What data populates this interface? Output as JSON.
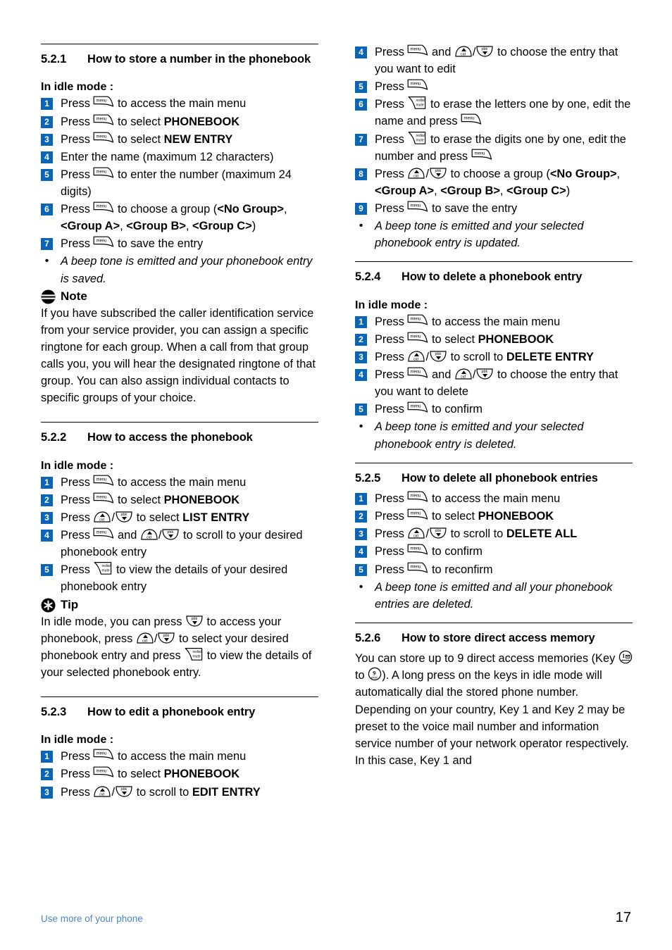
{
  "footer": {
    "left_text": "Use more of your phone",
    "page_number": "17",
    "link_color": "#4a86c8"
  },
  "theme": {
    "badge_color": "#0a66b5",
    "badge_text_color": "#ffffff"
  },
  "icons": {
    "menu": "menu-key-icon",
    "up": "up-cid-key-icon",
    "down": "down-pbk-key-icon",
    "redial": "redial-mute-key-icon",
    "note": "note-icon",
    "tip": "tip-icon",
    "key1": "key-1-icon",
    "key9": "key-9-icon",
    "menu_label": "menu",
    "up_label": "cid",
    "down_label": "pbk",
    "redial_label_top": "redial",
    "redial_label_bottom": "mute"
  },
  "left_column": {
    "s521": {
      "number": "5.2.1",
      "title": "How to store a number in the phonebook",
      "idle": "In idle mode :",
      "steps": [
        {
          "n": "1",
          "parts": [
            {
              "t": "text",
              "v": "Press "
            },
            {
              "t": "icon",
              "v": "menu"
            },
            {
              "t": "text",
              "v": " to access the main menu"
            }
          ]
        },
        {
          "n": "2",
          "parts": [
            {
              "t": "text",
              "v": "Press "
            },
            {
              "t": "icon",
              "v": "menu"
            },
            {
              "t": "text",
              "v": " to select "
            },
            {
              "t": "bold",
              "v": "PHONEBOOK"
            }
          ]
        },
        {
          "n": "3",
          "parts": [
            {
              "t": "text",
              "v": "Press "
            },
            {
              "t": "icon",
              "v": "menu"
            },
            {
              "t": "text",
              "v": " to select "
            },
            {
              "t": "bold",
              "v": "NEW ENTRY"
            }
          ]
        },
        {
          "n": "4",
          "parts": [
            {
              "t": "text",
              "v": "Enter the name (maximum 12 characters)"
            }
          ]
        },
        {
          "n": "5",
          "parts": [
            {
              "t": "text",
              "v": "Press "
            },
            {
              "t": "icon",
              "v": "menu"
            },
            {
              "t": "text",
              "v": " to enter the number (maximum 24 digits)"
            }
          ]
        },
        {
          "n": "6",
          "parts": [
            {
              "t": "text",
              "v": "Press "
            },
            {
              "t": "icon",
              "v": "menu"
            },
            {
              "t": "text",
              "v": " to choose a group ("
            },
            {
              "t": "bold",
              "v": "<No Group>"
            },
            {
              "t": "text",
              "v": ", "
            },
            {
              "t": "bold",
              "v": "<Group A>"
            },
            {
              "t": "text",
              "v": ", "
            },
            {
              "t": "bold",
              "v": "<Group B>"
            },
            {
              "t": "text",
              "v": ", "
            },
            {
              "t": "bold",
              "v": "<Group C>"
            },
            {
              "t": "text",
              "v": ")"
            }
          ]
        },
        {
          "n": "7",
          "parts": [
            {
              "t": "text",
              "v": "Press "
            },
            {
              "t": "icon",
              "v": "menu"
            },
            {
              "t": "text",
              "v": " to save the entry"
            }
          ]
        },
        {
          "n": "•",
          "italic": true,
          "parts": [
            {
              "t": "text",
              "v": "A beep tone is emitted and your phonebook entry is saved."
            }
          ]
        }
      ],
      "note": {
        "label": "Note",
        "text": "If you have subscribed the caller identification service from your service provider, you can assign a specific ringtone for each group. When a call from that group calls you, you will hear the designated ringtone of that group. You can also assign individual contacts to specific groups of your choice."
      }
    },
    "s522": {
      "number": "5.2.2",
      "title": "How to access the phonebook",
      "idle": "In idle mode :",
      "steps": [
        {
          "n": "1",
          "parts": [
            {
              "t": "text",
              "v": "Press "
            },
            {
              "t": "icon",
              "v": "menu"
            },
            {
              "t": "text",
              "v": " to access the main menu"
            }
          ]
        },
        {
          "n": "2",
          "parts": [
            {
              "t": "text",
              "v": "Press "
            },
            {
              "t": "icon",
              "v": "menu"
            },
            {
              "t": "text",
              "v": " to select "
            },
            {
              "t": "bold",
              "v": "PHONEBOOK"
            }
          ]
        },
        {
          "n": "3",
          "parts": [
            {
              "t": "text",
              "v": "Press "
            },
            {
              "t": "icon",
              "v": "up"
            },
            {
              "t": "text",
              "v": "/"
            },
            {
              "t": "icon",
              "v": "down"
            },
            {
              "t": "text",
              "v": " to select "
            },
            {
              "t": "bold",
              "v": "LIST ENTRY"
            }
          ]
        },
        {
          "n": "4",
          "parts": [
            {
              "t": "text",
              "v": "Press "
            },
            {
              "t": "icon",
              "v": "menu"
            },
            {
              "t": "text",
              "v": " and "
            },
            {
              "t": "icon",
              "v": "up"
            },
            {
              "t": "text",
              "v": "/"
            },
            {
              "t": "icon",
              "v": "down"
            },
            {
              "t": "text",
              "v": " to scroll to your desired phonebook entry"
            }
          ]
        },
        {
          "n": "5",
          "parts": [
            {
              "t": "text",
              "v": "Press "
            },
            {
              "t": "icon",
              "v": "redial"
            },
            {
              "t": "text",
              "v": " to view the details of your desired phonebook entry"
            }
          ]
        }
      ],
      "tip": {
        "label": "Tip",
        "parts": [
          {
            "t": "text",
            "v": "In idle mode, you can press "
          },
          {
            "t": "icon",
            "v": "down"
          },
          {
            "t": "text",
            "v": " to access your phonebook, press "
          },
          {
            "t": "icon",
            "v": "up"
          },
          {
            "t": "text",
            "v": "/"
          },
          {
            "t": "icon",
            "v": "down"
          },
          {
            "t": "text",
            "v": " to select your desired phonebook entry and press "
          },
          {
            "t": "icon",
            "v": "redial"
          },
          {
            "t": "text",
            "v": " to view the details of your selected phonebook entry."
          }
        ]
      }
    },
    "s523": {
      "number": "5.2.3",
      "title": "How to edit a phonebook entry",
      "idle": "In idle mode :",
      "steps": [
        {
          "n": "1",
          "parts": [
            {
              "t": "text",
              "v": "Press "
            },
            {
              "t": "icon",
              "v": "menu"
            },
            {
              "t": "text",
              "v": " to access the main menu"
            }
          ]
        },
        {
          "n": "2",
          "parts": [
            {
              "t": "text",
              "v": "Press "
            },
            {
              "t": "icon",
              "v": "menu"
            },
            {
              "t": "text",
              "v": " to select "
            },
            {
              "t": "bold",
              "v": "PHONEBOOK"
            }
          ]
        },
        {
          "n": "3",
          "parts": [
            {
              "t": "text",
              "v": "Press "
            },
            {
              "t": "icon",
              "v": "up"
            },
            {
              "t": "text",
              "v": "/"
            },
            {
              "t": "icon",
              "v": "down"
            },
            {
              "t": "text",
              "v": " to scroll to "
            },
            {
              "t": "bold",
              "v": "EDIT ENTRY"
            }
          ]
        }
      ]
    }
  },
  "right_column": {
    "s523_cont": {
      "steps": [
        {
          "n": "4",
          "parts": [
            {
              "t": "text",
              "v": "Press "
            },
            {
              "t": "icon",
              "v": "menu"
            },
            {
              "t": "text",
              "v": " and "
            },
            {
              "t": "icon",
              "v": "up"
            },
            {
              "t": "text",
              "v": "/"
            },
            {
              "t": "icon",
              "v": "down"
            },
            {
              "t": "text",
              "v": " to choose the entry that you want to edit"
            }
          ]
        },
        {
          "n": "5",
          "parts": [
            {
              "t": "text",
              "v": "Press "
            },
            {
              "t": "icon",
              "v": "menu"
            }
          ]
        },
        {
          "n": "6",
          "parts": [
            {
              "t": "text",
              "v": "Press "
            },
            {
              "t": "icon",
              "v": "redial"
            },
            {
              "t": "text",
              "v": " to erase the letters one by one, edit the name and press "
            },
            {
              "t": "icon",
              "v": "menu"
            }
          ]
        },
        {
          "n": "7",
          "parts": [
            {
              "t": "text",
              "v": "Press "
            },
            {
              "t": "icon",
              "v": "redial"
            },
            {
              "t": "text",
              "v": " to erase the digits one by one, edit the number and press "
            },
            {
              "t": "icon",
              "v": "menu"
            }
          ]
        },
        {
          "n": "8",
          "parts": [
            {
              "t": "text",
              "v": "Press "
            },
            {
              "t": "icon",
              "v": "up"
            },
            {
              "t": "text",
              "v": "/"
            },
            {
              "t": "icon",
              "v": "down"
            },
            {
              "t": "text",
              "v": " to choose a group ("
            },
            {
              "t": "bold",
              "v": "<No Group>"
            },
            {
              "t": "text",
              "v": ", "
            },
            {
              "t": "bold",
              "v": "<Group A>"
            },
            {
              "t": "text",
              "v": ", "
            },
            {
              "t": "bold",
              "v": "<Group B>"
            },
            {
              "t": "text",
              "v": ", "
            },
            {
              "t": "bold",
              "v": "<Group C>"
            },
            {
              "t": "text",
              "v": ")"
            }
          ]
        },
        {
          "n": "9",
          "parts": [
            {
              "t": "text",
              "v": "Press "
            },
            {
              "t": "icon",
              "v": "menu"
            },
            {
              "t": "text",
              "v": " to save the entry"
            }
          ]
        },
        {
          "n": "•",
          "italic": true,
          "parts": [
            {
              "t": "text",
              "v": "A beep tone is emitted and your selected phonebook entry is updated."
            }
          ]
        }
      ]
    },
    "s524": {
      "number": "5.2.4",
      "title": "How to delete a phonebook entry",
      "idle": "In idle mode :",
      "steps": [
        {
          "n": "1",
          "parts": [
            {
              "t": "text",
              "v": "Press "
            },
            {
              "t": "icon",
              "v": "menu"
            },
            {
              "t": "text",
              "v": " to access the main menu"
            }
          ]
        },
        {
          "n": "2",
          "parts": [
            {
              "t": "text",
              "v": "Press "
            },
            {
              "t": "icon",
              "v": "menu"
            },
            {
              "t": "text",
              "v": " to select "
            },
            {
              "t": "bold",
              "v": "PHONEBOOK"
            }
          ]
        },
        {
          "n": "3",
          "parts": [
            {
              "t": "text",
              "v": "Press "
            },
            {
              "t": "icon",
              "v": "up"
            },
            {
              "t": "text",
              "v": "/"
            },
            {
              "t": "icon",
              "v": "down"
            },
            {
              "t": "text",
              "v": " to scroll to "
            },
            {
              "t": "bold",
              "v": "DELETE ENTRY"
            }
          ]
        },
        {
          "n": "4",
          "parts": [
            {
              "t": "text",
              "v": "Press "
            },
            {
              "t": "icon",
              "v": "menu"
            },
            {
              "t": "text",
              "v": " and "
            },
            {
              "t": "icon",
              "v": "up"
            },
            {
              "t": "text",
              "v": "/"
            },
            {
              "t": "icon",
              "v": "down"
            },
            {
              "t": "text",
              "v": " to choose the entry that you want to delete"
            }
          ]
        },
        {
          "n": "5",
          "parts": [
            {
              "t": "text",
              "v": "Press "
            },
            {
              "t": "icon",
              "v": "menu"
            },
            {
              "t": "text",
              "v": " to confirm"
            }
          ]
        },
        {
          "n": "•",
          "italic": true,
          "parts": [
            {
              "t": "text",
              "v": "A beep tone is emitted and your selected phonebook entry is deleted."
            }
          ]
        }
      ]
    },
    "s525": {
      "number": "5.2.5",
      "title": "How to delete all phonebook entries",
      "steps": [
        {
          "n": "1",
          "parts": [
            {
              "t": "text",
              "v": "Press "
            },
            {
              "t": "icon",
              "v": "menu"
            },
            {
              "t": "text",
              "v": " to access the main menu"
            }
          ]
        },
        {
          "n": "2",
          "parts": [
            {
              "t": "text",
              "v": "Press "
            },
            {
              "t": "icon",
              "v": "menu"
            },
            {
              "t": "text",
              "v": " to select "
            },
            {
              "t": "bold",
              "v": "PHONEBOOK"
            }
          ]
        },
        {
          "n": "3",
          "parts": [
            {
              "t": "text",
              "v": "Press "
            },
            {
              "t": "icon",
              "v": "up"
            },
            {
              "t": "text",
              "v": "/"
            },
            {
              "t": "icon",
              "v": "down"
            },
            {
              "t": "text",
              "v": " to scroll to "
            },
            {
              "t": "bold",
              "v": "DELETE ALL"
            }
          ]
        },
        {
          "n": "4",
          "parts": [
            {
              "t": "text",
              "v": "Press "
            },
            {
              "t": "icon",
              "v": "menu"
            },
            {
              "t": "text",
              "v": " to confirm"
            }
          ]
        },
        {
          "n": "5",
          "parts": [
            {
              "t": "text",
              "v": "Press "
            },
            {
              "t": "icon",
              "v": "menu"
            },
            {
              "t": "text",
              "v": " to reconfirm"
            }
          ]
        },
        {
          "n": "•",
          "italic": true,
          "parts": [
            {
              "t": "text",
              "v": "A beep tone is emitted and all your phonebook entries are deleted."
            }
          ]
        }
      ]
    },
    "s526": {
      "number": "5.2.6",
      "title": "How to store direct access memory",
      "para1_parts": [
        {
          "t": "text",
          "v": "You can store up to 9 direct access memories (Key "
        },
        {
          "t": "icon",
          "v": "key1"
        },
        {
          "t": "text",
          "v": " to "
        },
        {
          "t": "icon",
          "v": "key9"
        },
        {
          "t": "text",
          "v": "). A long press on the keys in idle mode will automatically dial the stored phone number."
        }
      ],
      "para2": "Depending on your country, Key 1 and Key 2 may be preset to the voice mail number and information service number of your network operator respectively. In this case, Key 1 and"
    }
  }
}
